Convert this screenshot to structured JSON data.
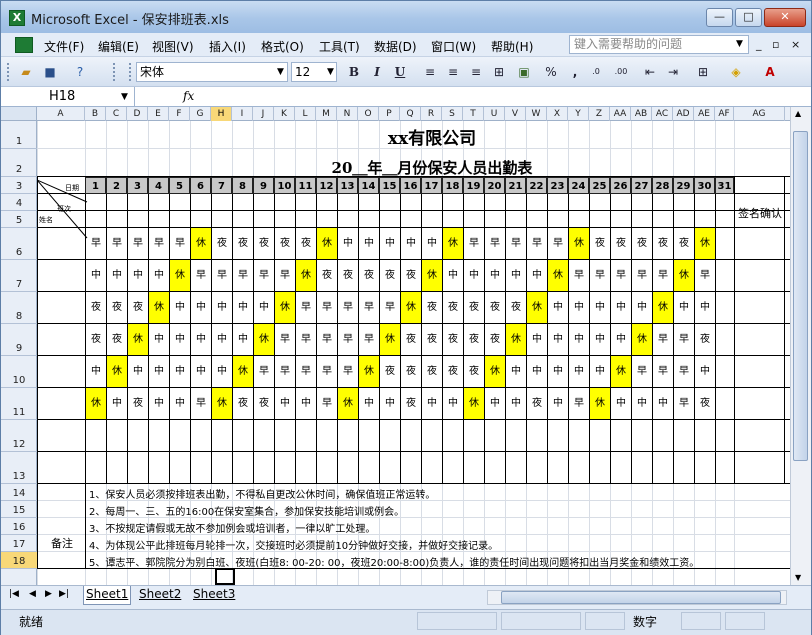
{
  "window": {
    "title": "Microsoft Excel - 保安排班表.xls",
    "app_icon_letter": "X",
    "min": "—",
    "max": "□",
    "close": "✕"
  },
  "menu": {
    "items": [
      "文件(F)",
      "编辑(E)",
      "视图(V)",
      "插入(I)",
      "格式(O)",
      "工具(T)",
      "数据(D)",
      "窗口(W)",
      "帮助(H)"
    ],
    "help_placeholder": "键入需要帮助的问题",
    "mdi": [
      "_",
      "▫",
      "×"
    ]
  },
  "toolbar": {
    "font": "宋体",
    "size": "12",
    "bold": "B",
    "italic": "I",
    "underline": "U",
    "percent": "%",
    "comma": ","
  },
  "formula": {
    "cell_ref": "H18",
    "fx": "fx",
    "value": ""
  },
  "columns": [
    "A",
    "B",
    "C",
    "D",
    "E",
    "F",
    "G",
    "H",
    "I",
    "J",
    "K",
    "L",
    "M",
    "N",
    "O",
    "P",
    "Q",
    "R",
    "S",
    "T",
    "U",
    "V",
    "W",
    "X",
    "Y",
    "Z",
    "AA",
    "AB",
    "AC",
    "AD",
    "AE",
    "AF",
    "AG"
  ],
  "selected_column": "H",
  "rows": [
    "1",
    "2",
    "3",
    "4",
    "5",
    "6",
    "7",
    "8",
    "9",
    "10",
    "11",
    "12",
    "13",
    "14",
    "15",
    "16",
    "17",
    "18"
  ],
  "selected_row": "18",
  "sheet": {
    "company": "xx有限公司",
    "subtitle": "20＿年＿月份保安人员出勤表",
    "header_date": "日期",
    "header_shift": "班次",
    "header_name": "姓名",
    "sign": "签名确认",
    "days": [
      "1",
      "2",
      "3",
      "4",
      "5",
      "6",
      "7",
      "8",
      "9",
      "10",
      "11",
      "12",
      "13",
      "14",
      "15",
      "16",
      "17",
      "18",
      "19",
      "20",
      "21",
      "22",
      "23",
      "24",
      "25",
      "26",
      "27",
      "28",
      "29",
      "30",
      "31"
    ],
    "schedule": [
      [
        "早",
        "早",
        "早",
        "早",
        "早",
        "休",
        "夜",
        "夜",
        "夜",
        "夜",
        "夜",
        "休",
        "中",
        "中",
        "中",
        "中",
        "中",
        "休",
        "早",
        "早",
        "早",
        "早",
        "早",
        "休",
        "夜",
        "夜",
        "夜",
        "夜",
        "夜",
        "休"
      ],
      [
        "中",
        "中",
        "中",
        "中",
        "休",
        "早",
        "早",
        "早",
        "早",
        "早",
        "休",
        "夜",
        "夜",
        "夜",
        "夜",
        "夜",
        "休",
        "中",
        "中",
        "中",
        "中",
        "中",
        "休",
        "早",
        "早",
        "早",
        "早",
        "早",
        "休",
        "早"
      ],
      [
        "夜",
        "夜",
        "夜",
        "休",
        "中",
        "中",
        "中",
        "中",
        "中",
        "休",
        "早",
        "早",
        "早",
        "早",
        "早",
        "休",
        "夜",
        "夜",
        "夜",
        "夜",
        "夜",
        "休",
        "中",
        "中",
        "中",
        "中",
        "中",
        "休",
        "中",
        "中"
      ],
      [
        "夜",
        "夜",
        "休",
        "中",
        "中",
        "中",
        "中",
        "中",
        "休",
        "早",
        "早",
        "早",
        "早",
        "早",
        "休",
        "夜",
        "夜",
        "夜",
        "夜",
        "夜",
        "休",
        "中",
        "中",
        "中",
        "中",
        "中",
        "休",
        "早",
        "早",
        "夜"
      ],
      [
        "中",
        "休",
        "中",
        "中",
        "中",
        "中",
        "中",
        "休",
        "早",
        "早",
        "早",
        "早",
        "早",
        "休",
        "夜",
        "夜",
        "夜",
        "夜",
        "夜",
        "休",
        "中",
        "中",
        "中",
        "中",
        "中",
        "休",
        "早",
        "早",
        "早",
        "中"
      ],
      [
        "休",
        "中",
        "夜",
        "中",
        "中",
        "早",
        "休",
        "夜",
        "夜",
        "中",
        "中",
        "早",
        "休",
        "中",
        "中",
        "夜",
        "中",
        "中",
        "休",
        "中",
        "中",
        "夜",
        "中",
        "早",
        "休",
        "中",
        "中",
        "中",
        "早",
        "夜"
      ]
    ],
    "remark_label": "备注",
    "notes": [
      "1、保安人员必须按排班表出勤，不得私自更改公休时间，确保值班正常运转。",
      "2、每周一、三、五的16:00在保安室集合，参加保安技能培训或例会。",
      "3、不按规定请假或无故不参加例会或培训者，一律以旷工处理。",
      "4、为体现公平此排班每月轮排一次，交接班时必须提前10分钟做好交接，并做好交接记录。",
      "5、谭志平、郭院院分为别白班、夜班(白班8: 00-20: 00，夜班20:00-8:00)负责人，谁的责任时间出现问题将扣出当月奖金和绩效工资。"
    ]
  },
  "tabs": [
    "Sheet1",
    "Sheet2",
    "Sheet3"
  ],
  "active_tab": "Sheet1",
  "status": {
    "text": "就绪",
    "mode": "数字"
  },
  "colors": {
    "rest": "#ffff00",
    "selection": "#f8d878",
    "header_bg": "#c8c8c8"
  }
}
